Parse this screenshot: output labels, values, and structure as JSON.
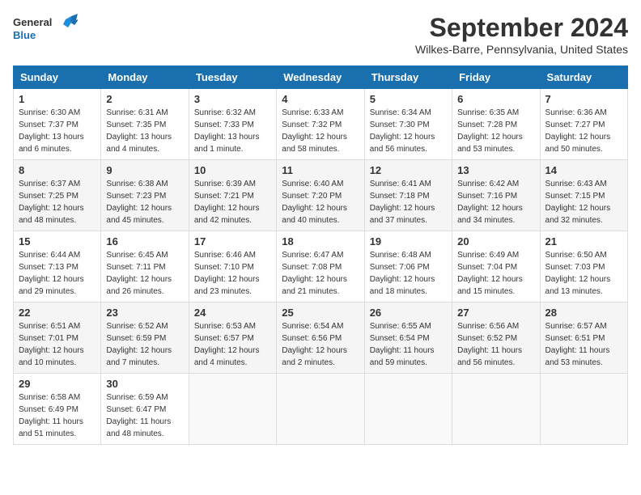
{
  "header": {
    "logo_line1": "General",
    "logo_line2": "Blue",
    "month": "September 2024",
    "location": "Wilkes-Barre, Pennsylvania, United States"
  },
  "weekdays": [
    "Sunday",
    "Monday",
    "Tuesday",
    "Wednesday",
    "Thursday",
    "Friday",
    "Saturday"
  ],
  "weeks": [
    [
      {
        "day": "1",
        "sunrise": "6:30 AM",
        "sunset": "7:37 PM",
        "daylight": "13 hours and 6 minutes."
      },
      {
        "day": "2",
        "sunrise": "6:31 AM",
        "sunset": "7:35 PM",
        "daylight": "13 hours and 4 minutes."
      },
      {
        "day": "3",
        "sunrise": "6:32 AM",
        "sunset": "7:33 PM",
        "daylight": "13 hours and 1 minute."
      },
      {
        "day": "4",
        "sunrise": "6:33 AM",
        "sunset": "7:32 PM",
        "daylight": "12 hours and 58 minutes."
      },
      {
        "day": "5",
        "sunrise": "6:34 AM",
        "sunset": "7:30 PM",
        "daylight": "12 hours and 56 minutes."
      },
      {
        "day": "6",
        "sunrise": "6:35 AM",
        "sunset": "7:28 PM",
        "daylight": "12 hours and 53 minutes."
      },
      {
        "day": "7",
        "sunrise": "6:36 AM",
        "sunset": "7:27 PM",
        "daylight": "12 hours and 50 minutes."
      }
    ],
    [
      {
        "day": "8",
        "sunrise": "6:37 AM",
        "sunset": "7:25 PM",
        "daylight": "12 hours and 48 minutes."
      },
      {
        "day": "9",
        "sunrise": "6:38 AM",
        "sunset": "7:23 PM",
        "daylight": "12 hours and 45 minutes."
      },
      {
        "day": "10",
        "sunrise": "6:39 AM",
        "sunset": "7:21 PM",
        "daylight": "12 hours and 42 minutes."
      },
      {
        "day": "11",
        "sunrise": "6:40 AM",
        "sunset": "7:20 PM",
        "daylight": "12 hours and 40 minutes."
      },
      {
        "day": "12",
        "sunrise": "6:41 AM",
        "sunset": "7:18 PM",
        "daylight": "12 hours and 37 minutes."
      },
      {
        "day": "13",
        "sunrise": "6:42 AM",
        "sunset": "7:16 PM",
        "daylight": "12 hours and 34 minutes."
      },
      {
        "day": "14",
        "sunrise": "6:43 AM",
        "sunset": "7:15 PM",
        "daylight": "12 hours and 32 minutes."
      }
    ],
    [
      {
        "day": "15",
        "sunrise": "6:44 AM",
        "sunset": "7:13 PM",
        "daylight": "12 hours and 29 minutes."
      },
      {
        "day": "16",
        "sunrise": "6:45 AM",
        "sunset": "7:11 PM",
        "daylight": "12 hours and 26 minutes."
      },
      {
        "day": "17",
        "sunrise": "6:46 AM",
        "sunset": "7:10 PM",
        "daylight": "12 hours and 23 minutes."
      },
      {
        "day": "18",
        "sunrise": "6:47 AM",
        "sunset": "7:08 PM",
        "daylight": "12 hours and 21 minutes."
      },
      {
        "day": "19",
        "sunrise": "6:48 AM",
        "sunset": "7:06 PM",
        "daylight": "12 hours and 18 minutes."
      },
      {
        "day": "20",
        "sunrise": "6:49 AM",
        "sunset": "7:04 PM",
        "daylight": "12 hours and 15 minutes."
      },
      {
        "day": "21",
        "sunrise": "6:50 AM",
        "sunset": "7:03 PM",
        "daylight": "12 hours and 13 minutes."
      }
    ],
    [
      {
        "day": "22",
        "sunrise": "6:51 AM",
        "sunset": "7:01 PM",
        "daylight": "12 hours and 10 minutes."
      },
      {
        "day": "23",
        "sunrise": "6:52 AM",
        "sunset": "6:59 PM",
        "daylight": "12 hours and 7 minutes."
      },
      {
        "day": "24",
        "sunrise": "6:53 AM",
        "sunset": "6:57 PM",
        "daylight": "12 hours and 4 minutes."
      },
      {
        "day": "25",
        "sunrise": "6:54 AM",
        "sunset": "6:56 PM",
        "daylight": "12 hours and 2 minutes."
      },
      {
        "day": "26",
        "sunrise": "6:55 AM",
        "sunset": "6:54 PM",
        "daylight": "11 hours and 59 minutes."
      },
      {
        "day": "27",
        "sunrise": "6:56 AM",
        "sunset": "6:52 PM",
        "daylight": "11 hours and 56 minutes."
      },
      {
        "day": "28",
        "sunrise": "6:57 AM",
        "sunset": "6:51 PM",
        "daylight": "11 hours and 53 minutes."
      }
    ],
    [
      {
        "day": "29",
        "sunrise": "6:58 AM",
        "sunset": "6:49 PM",
        "daylight": "11 hours and 51 minutes."
      },
      {
        "day": "30",
        "sunrise": "6:59 AM",
        "sunset": "6:47 PM",
        "daylight": "11 hours and 48 minutes."
      },
      null,
      null,
      null,
      null,
      null
    ]
  ],
  "labels": {
    "sunrise": "Sunrise:",
    "sunset": "Sunset:",
    "daylight": "Daylight:"
  }
}
